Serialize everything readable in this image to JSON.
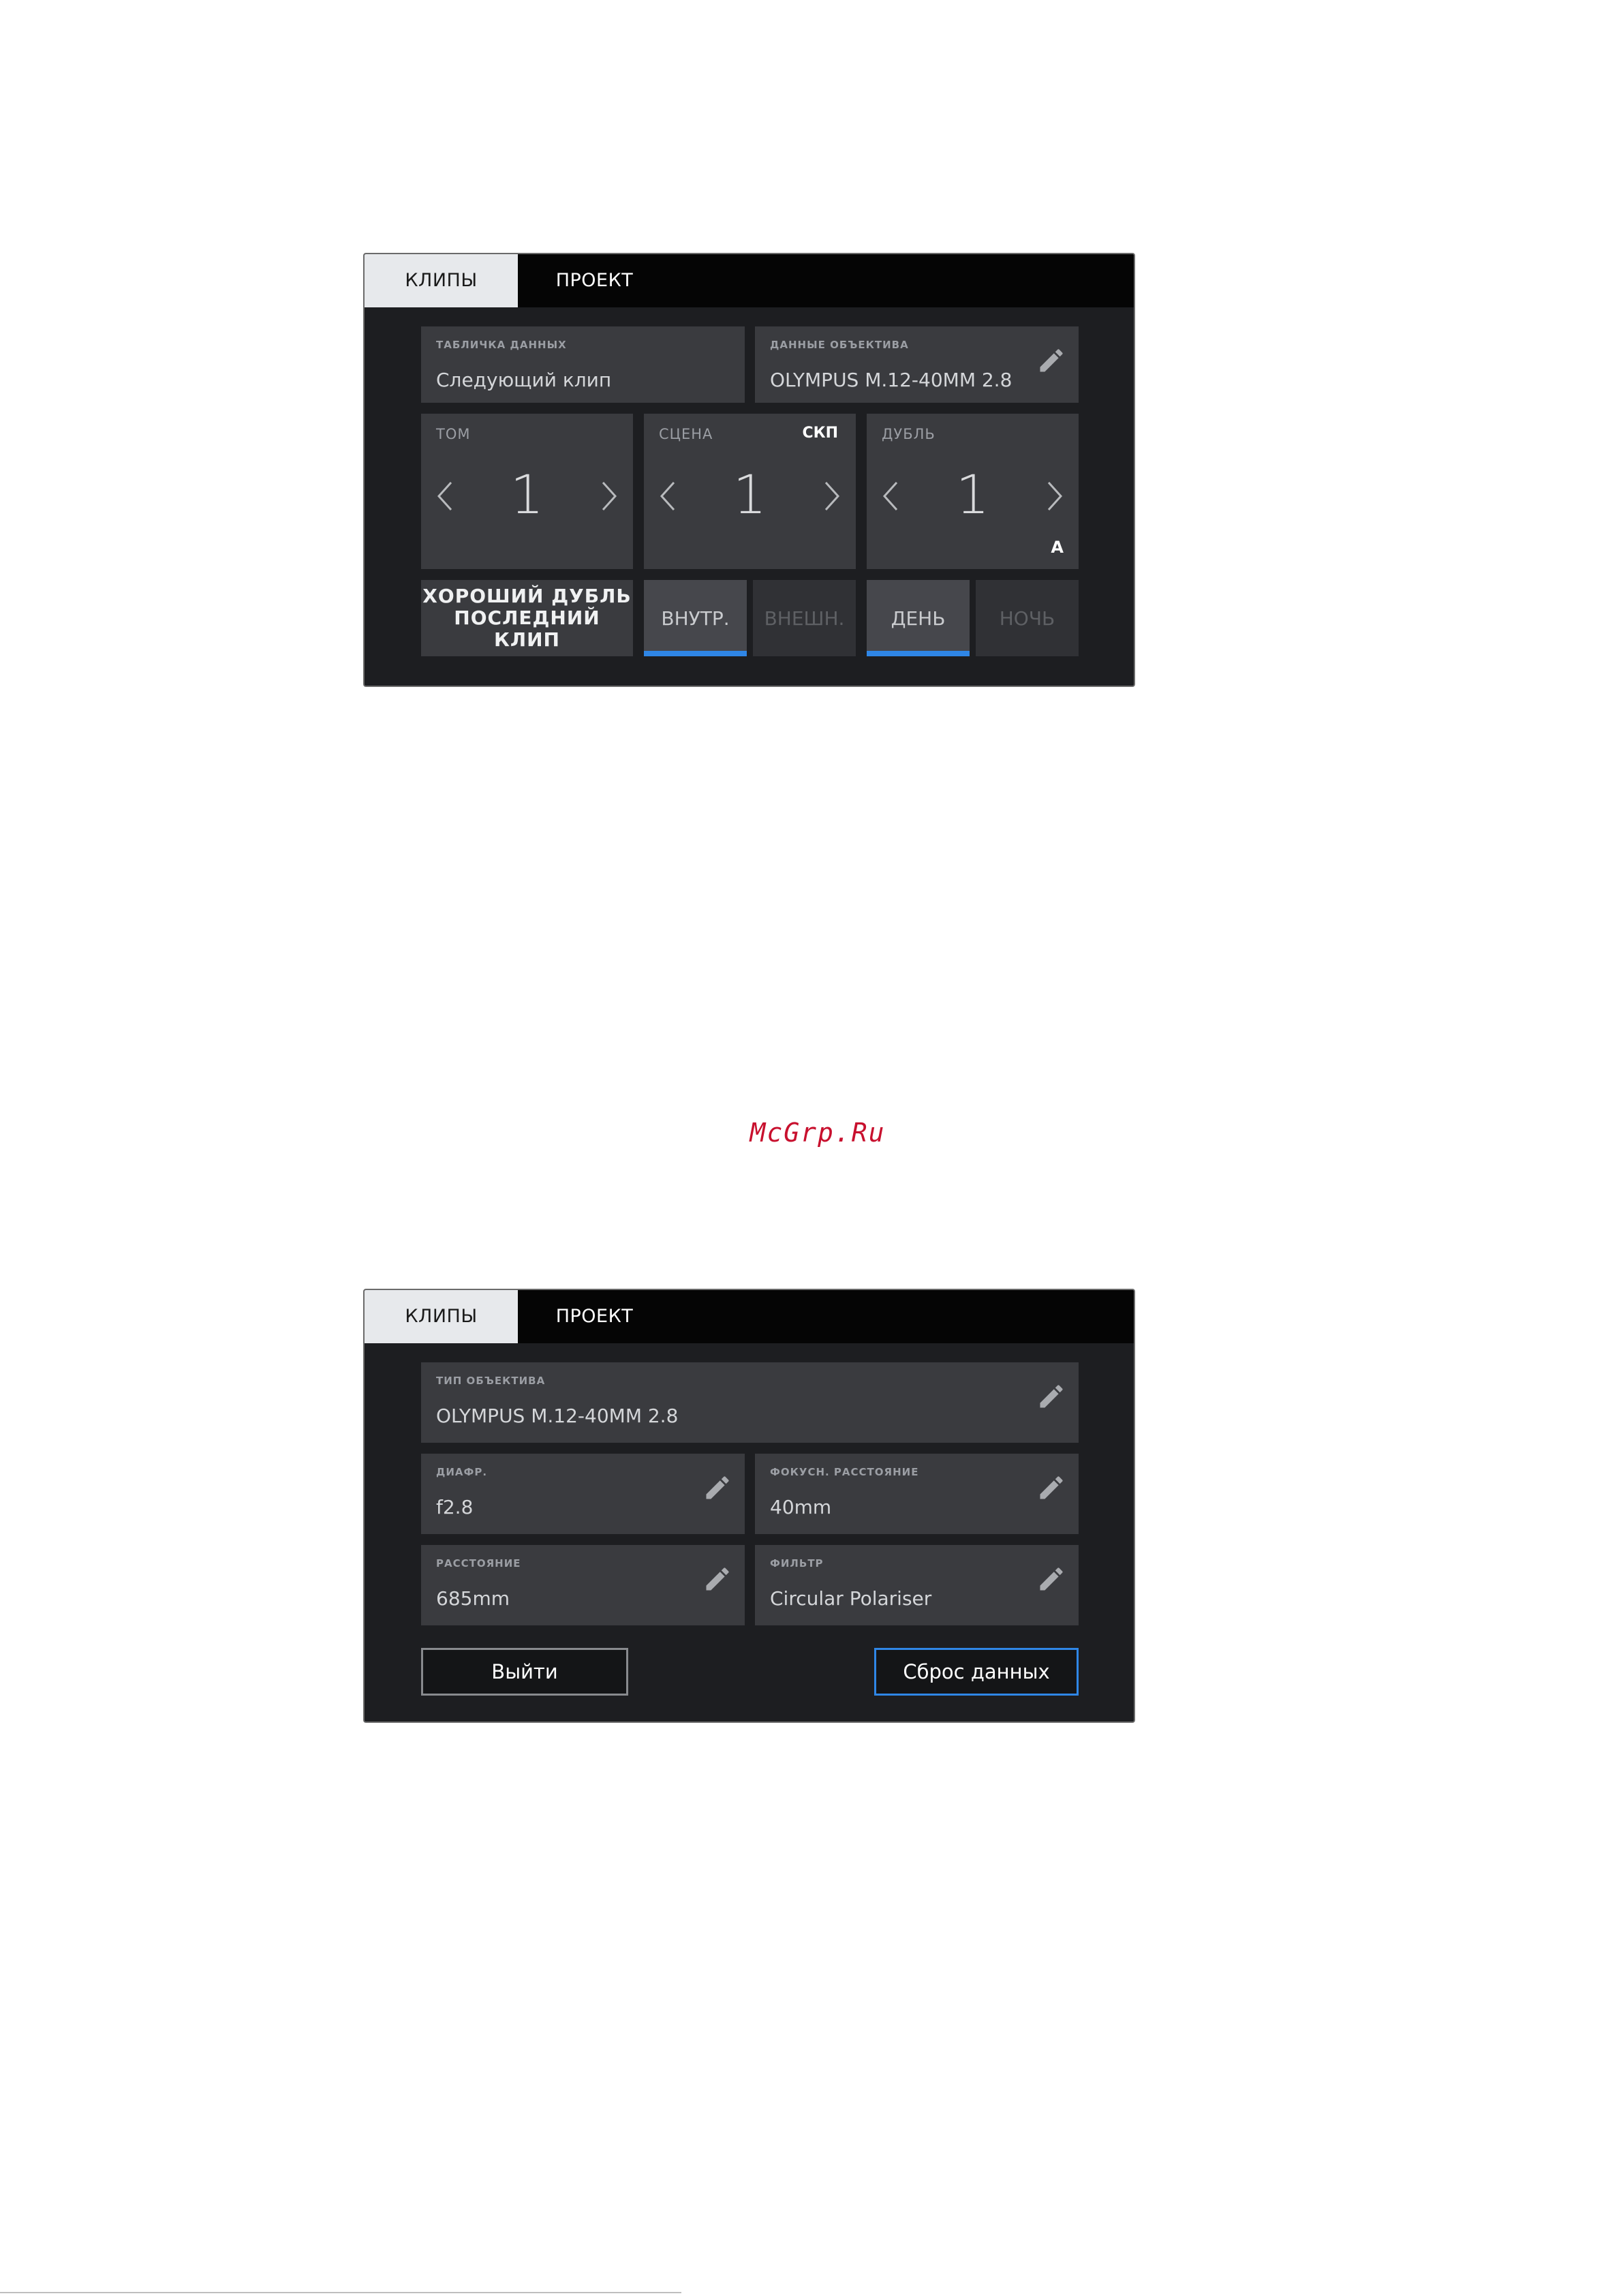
{
  "watermark": "McGrp.Ru",
  "panel1": {
    "tabs": [
      {
        "label": "КЛИПЫ",
        "active": true
      },
      {
        "label": "ПРОЕКТ",
        "active": false
      }
    ],
    "slate": {
      "label": "ТАБЛИЧКА ДАННЫХ",
      "value": "Следующий клип"
    },
    "lens_data": {
      "label": "ДАННЫЕ ОБЪЕКТИВА",
      "value": "OLYMPUS M.12-40MM 2.8",
      "icon": "pencil-icon"
    },
    "reel": {
      "label": "ТОМ",
      "value": "1"
    },
    "scene": {
      "label": "СЦЕНА",
      "tag": "СКП",
      "value": "1"
    },
    "take": {
      "label": "ДУБЛЬ",
      "value": "1",
      "suffix": "A"
    },
    "good_take": {
      "line1": "ХОРОШИЙ ДУБЛЬ",
      "line2": "ПОСЛЕДНИЙ КЛИП"
    },
    "interior": {
      "label": "ВНУТР.",
      "selected": true
    },
    "exterior": {
      "label": "ВНЕШН.",
      "selected": false
    },
    "day": {
      "label": "ДЕНЬ",
      "selected": true
    },
    "night": {
      "label": "НОЧЬ",
      "selected": false
    },
    "accent_color": "#2f86e6"
  },
  "panel2": {
    "tabs": [
      {
        "label": "КЛИПЫ",
        "active": true
      },
      {
        "label": "ПРОЕКТ",
        "active": false
      }
    ],
    "lens_type": {
      "label": "ТИП ОБЪЕКТИВА",
      "value": "OLYMPUS M.12-40MM 2.8"
    },
    "iris": {
      "label": "ДИАФР.",
      "value": "f2.8"
    },
    "focal_length": {
      "label": "ФОКУСН. РАССТОЯНИЕ",
      "value": "40mm"
    },
    "distance": {
      "label": "РАССТОЯНИЕ",
      "value": "685mm"
    },
    "filter": {
      "label": "ФИЛЬТР",
      "value": "Circular Polariser"
    },
    "exit_button": "Выйти",
    "reset_button": "Сброс данных"
  }
}
